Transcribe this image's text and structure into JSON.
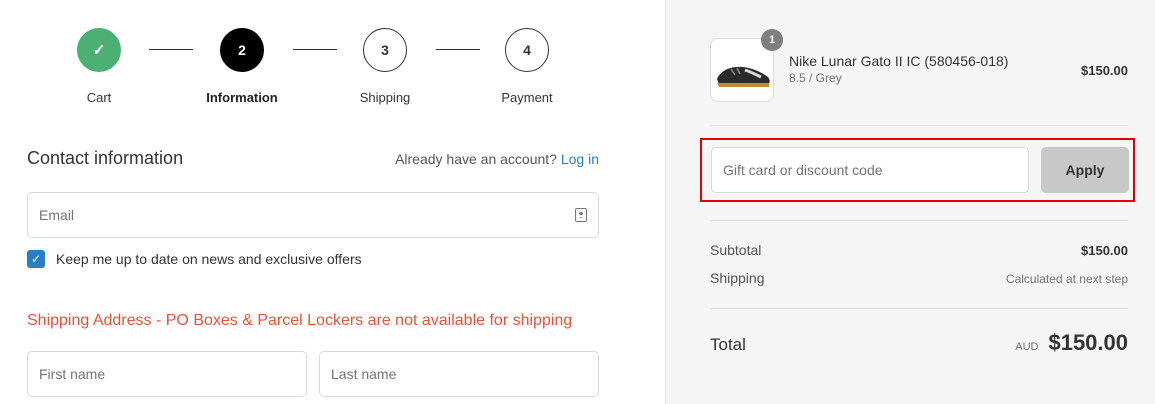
{
  "steps": [
    {
      "number": "✓",
      "label": "Cart",
      "state": "done"
    },
    {
      "number": "2",
      "label": "Information",
      "state": "active"
    },
    {
      "number": "3",
      "label": "Shipping",
      "state": "pending"
    },
    {
      "number": "4",
      "label": "Payment",
      "state": "pending"
    }
  ],
  "contact": {
    "title": "Contact information",
    "account_prompt": "Already have an account?",
    "login_link": "Log in",
    "email_placeholder": "Email",
    "newsletter_label": "Keep me up to date on news and exclusive offers",
    "newsletter_checked": true
  },
  "shipping": {
    "warning": "Shipping Address - PO Boxes & Parcel Lockers are not available for shipping",
    "first_name_placeholder": "First name",
    "last_name_placeholder": "Last name"
  },
  "order": {
    "product_name": "Nike Lunar Gato II IC (580456-018)",
    "variant": "8.5 / Grey",
    "price": "$150.00",
    "quantity": "1",
    "discount_placeholder": "Gift card or discount code",
    "apply_label": "Apply",
    "subtotal_label": "Subtotal",
    "subtotal_value": "$150.00",
    "shipping_label": "Shipping",
    "shipping_value": "Calculated at next step",
    "total_label": "Total",
    "currency": "AUD",
    "total_value": "$150.00"
  },
  "colors": {
    "done_step": "#4caf73",
    "active_step": "#000000",
    "link": "#2a7ec4",
    "warning": "#e8513a",
    "highlight_box": "#e00000"
  }
}
